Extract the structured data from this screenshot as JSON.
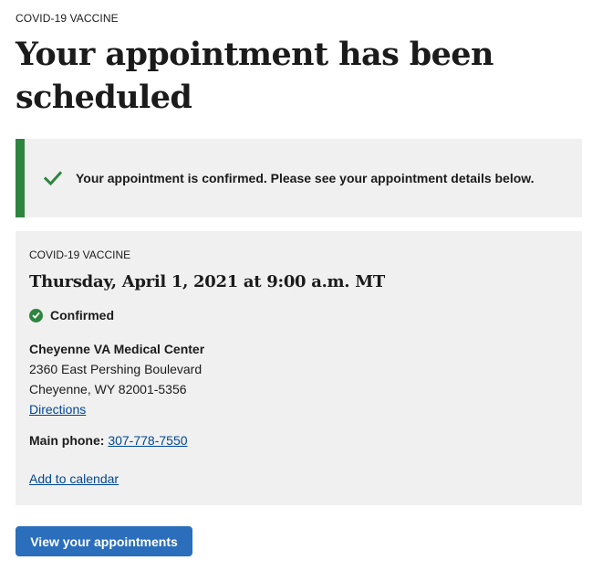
{
  "header": {
    "eyebrow": "COVID-19 VACCINE",
    "title": "Your appointment has been scheduled"
  },
  "alert": {
    "icon": "check-icon",
    "message": "Your appointment is confirmed. Please see your appointment details below.",
    "accent_color": "#2e8540"
  },
  "appointment": {
    "eyebrow": "COVID-19 VACCINE",
    "datetime": "Thursday, April 1, 2021 at 9:00 a.m. MT",
    "status": {
      "icon": "check-circle-icon",
      "label": "Confirmed",
      "color": "#2e8540"
    },
    "facility": {
      "name": "Cheyenne VA Medical Center",
      "address_line1": "2360 East Pershing Boulevard",
      "address_line2": "Cheyenne, WY 82001-5356",
      "directions_label": "Directions"
    },
    "phone": {
      "label": "Main phone:",
      "number": "307-778-7550"
    },
    "add_to_calendar_label": "Add to calendar"
  },
  "actions": {
    "view_appointments_label": "View your appointments",
    "button_color": "#2a6ebc"
  },
  "colors": {
    "link": "#004795",
    "panel_background": "#f0f0f0",
    "text": "#1b1b1b"
  }
}
